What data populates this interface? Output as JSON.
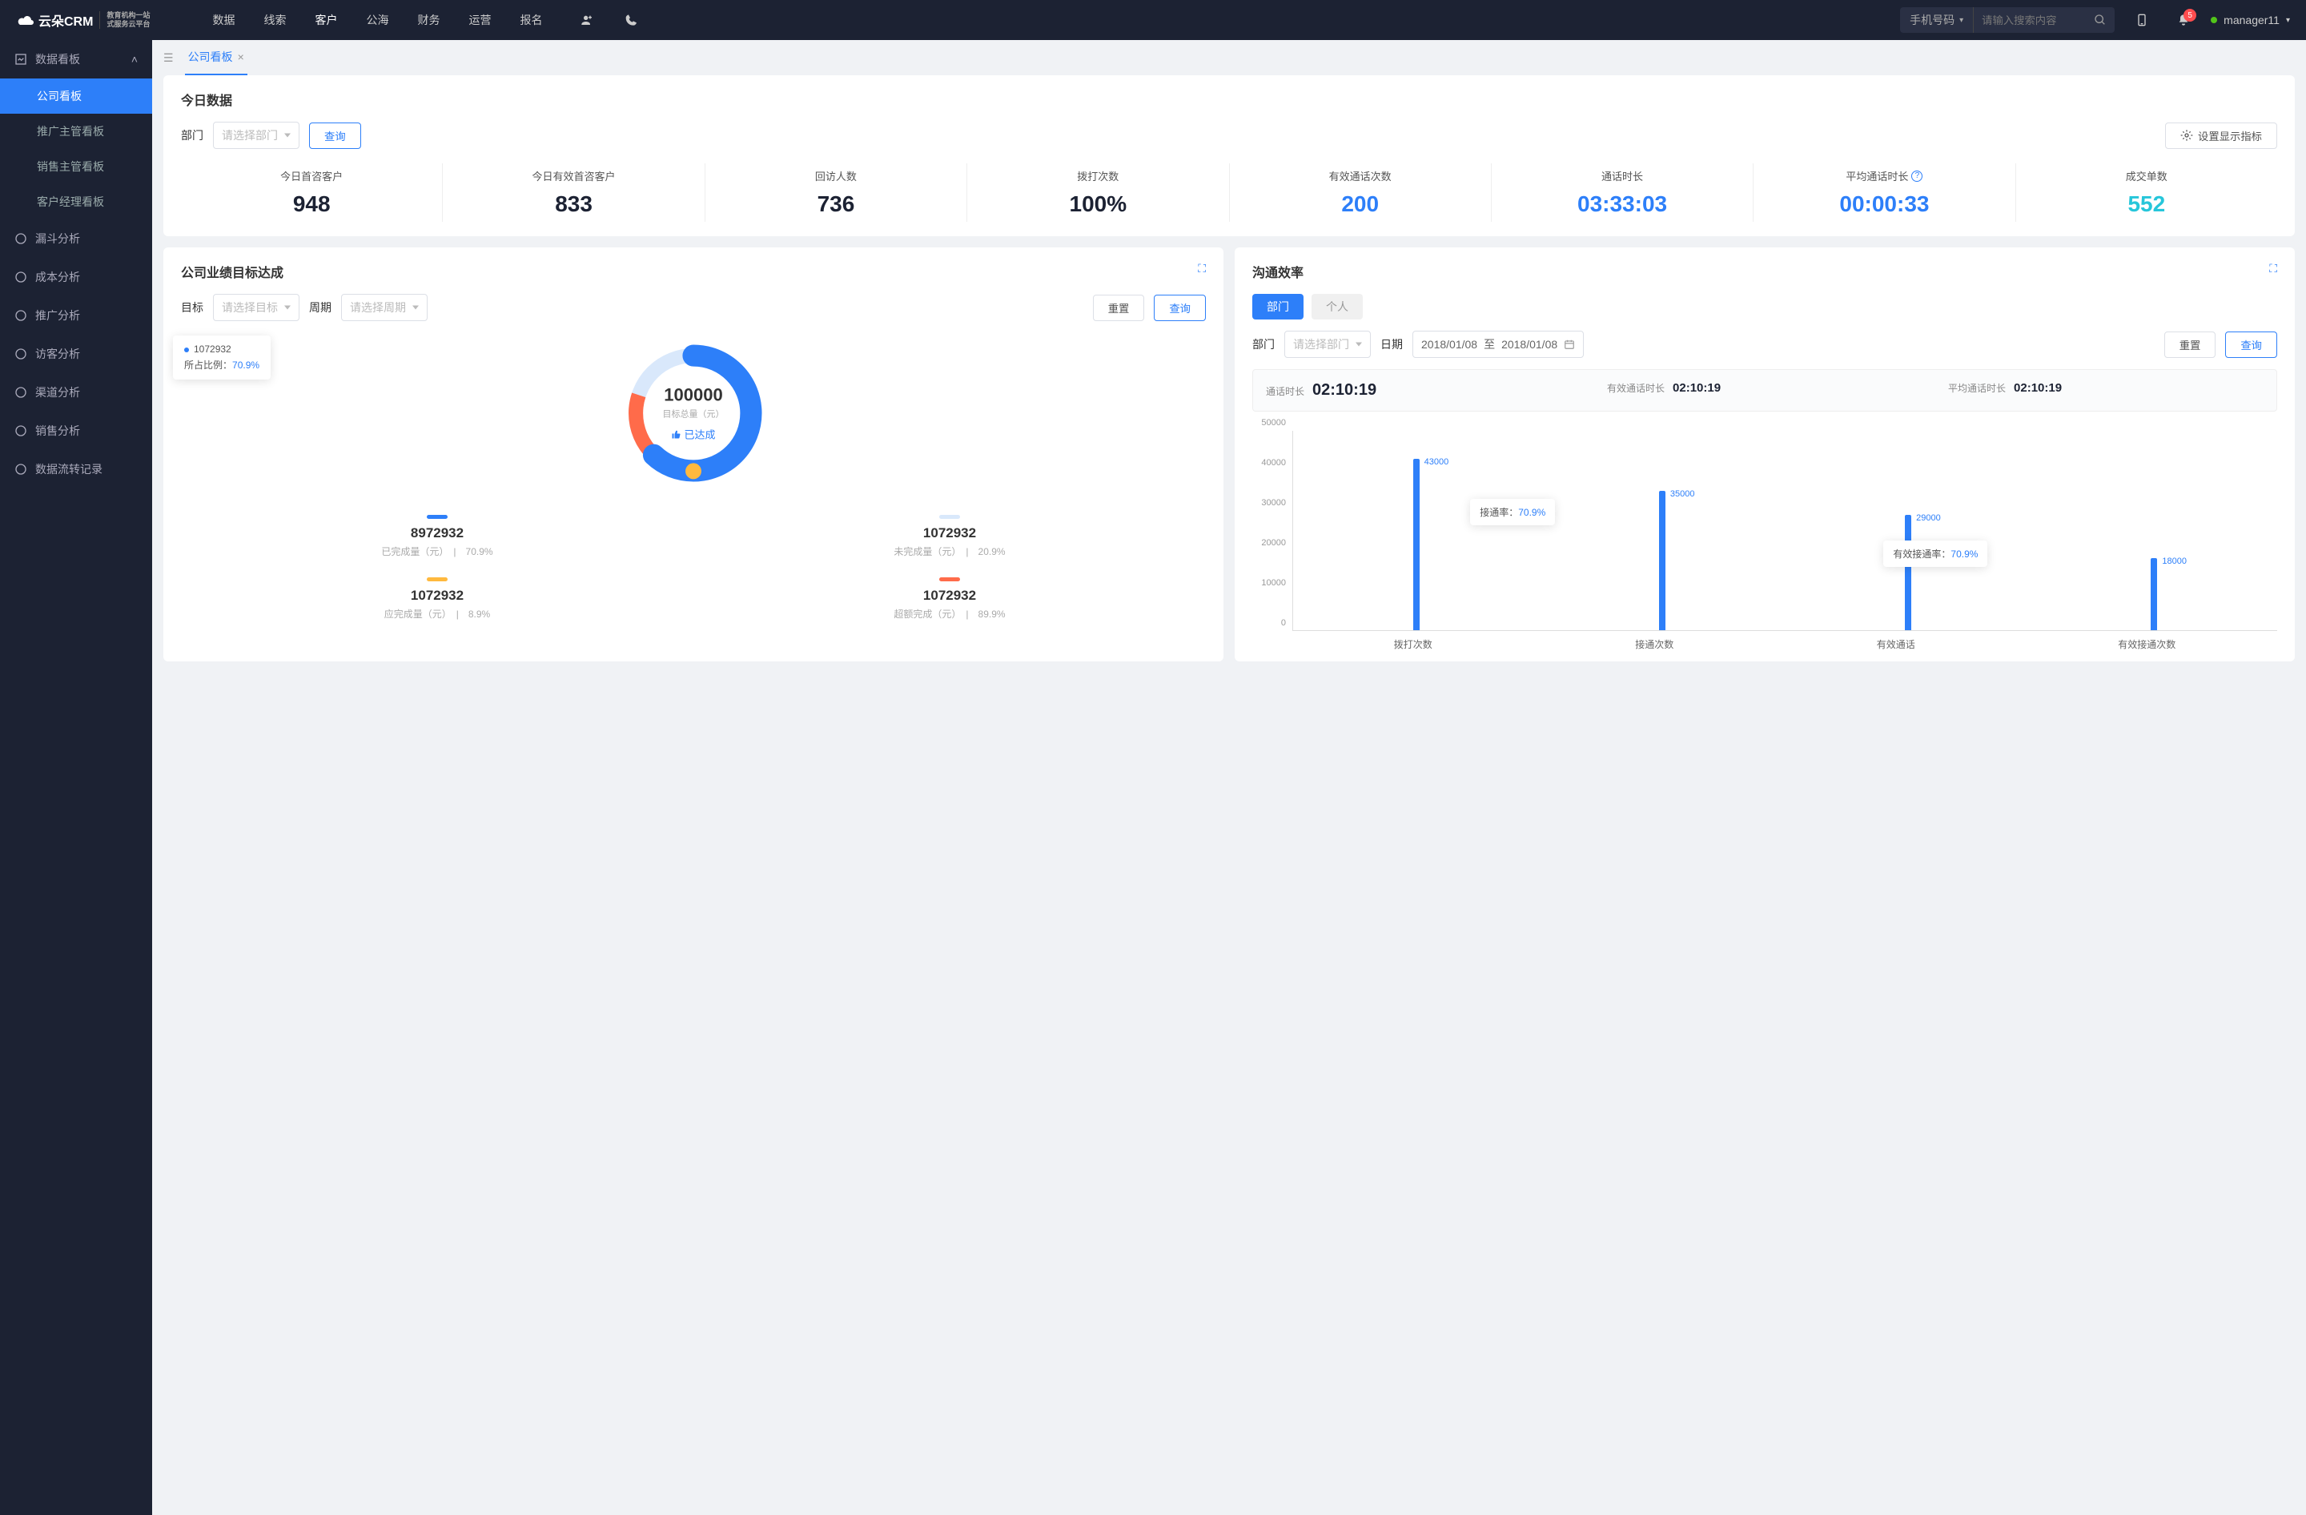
{
  "header": {
    "logo_main": "云朵CRM",
    "logo_sub1": "教育机构一站",
    "logo_sub2": "式服务云平台",
    "nav": [
      "数据",
      "线索",
      "客户",
      "公海",
      "财务",
      "运营",
      "报名"
    ],
    "nav_active": 2,
    "search_type": "手机号码",
    "search_placeholder": "请输入搜索内容",
    "badge_count": "5",
    "username": "manager11"
  },
  "sidebar": {
    "group": "数据看板",
    "items": [
      "公司看板",
      "推广主管看板",
      "销售主管看板",
      "客户经理看板"
    ],
    "active_item": 0,
    "others": [
      "漏斗分析",
      "成本分析",
      "推广分析",
      "访客分析",
      "渠道分析",
      "销售分析",
      "数据流转记录"
    ]
  },
  "tab": {
    "label": "公司看板"
  },
  "today": {
    "title": "今日数据",
    "dept_label": "部门",
    "dept_placeholder": "请选择部门",
    "query_btn": "查询",
    "settings_btn": "设置显示指标",
    "stats": [
      {
        "label": "今日首咨客户",
        "value": "948",
        "cls": "v-dark"
      },
      {
        "label": "今日有效首咨客户",
        "value": "833",
        "cls": "v-dark"
      },
      {
        "label": "回访人数",
        "value": "736",
        "cls": "v-dark"
      },
      {
        "label": "拨打次数",
        "value": "100%",
        "cls": "v-dark"
      },
      {
        "label": "有效通话次数",
        "value": "200",
        "cls": "v-blue"
      },
      {
        "label": "通话时长",
        "value": "03:33:03",
        "cls": "v-blue"
      },
      {
        "label": "平均通话时长",
        "value": "00:00:33",
        "cls": "v-blue",
        "help": true
      },
      {
        "label": "成交单数",
        "value": "552",
        "cls": "v-cyan"
      }
    ]
  },
  "goal": {
    "title": "公司业绩目标达成",
    "target_label": "目标",
    "target_placeholder": "请选择目标",
    "period_label": "周期",
    "period_placeholder": "请选择周期",
    "reset_btn": "重置",
    "query_btn": "查询",
    "center_value": "100000",
    "center_label": "目标总量（元）",
    "center_tag": "已达成",
    "tooltip_value": "1072932",
    "tooltip_ratio_label": "所占比例：",
    "tooltip_ratio": "70.9%",
    "legends": [
      {
        "color": "#2d7ff9",
        "value": "8972932",
        "desc": "已完成量（元）",
        "pct": "70.9%"
      },
      {
        "color": "#d9e8fb",
        "value": "1072932",
        "desc": "未完成量（元）",
        "pct": "20.9%"
      },
      {
        "color": "#ffb93e",
        "value": "1072932",
        "desc": "应完成量（元）",
        "pct": "8.9%"
      },
      {
        "color": "#ff6b4a",
        "value": "1072932",
        "desc": "超额完成（元）",
        "pct": "89.9%"
      }
    ]
  },
  "comm": {
    "title": "沟通效率",
    "seg_tabs": [
      "部门",
      "个人"
    ],
    "dept_label": "部门",
    "dept_placeholder": "请选择部门",
    "date_label": "日期",
    "date_from": "2018/01/08",
    "date_to_label": "至",
    "date_to": "2018/01/08",
    "reset_btn": "重置",
    "query_btn": "查询",
    "summary": [
      {
        "label": "通话时长",
        "value": "02:10:19",
        "big": true
      },
      {
        "label": "有效通话时长",
        "value": "02:10:19"
      },
      {
        "label": "平均通话时长",
        "value": "02:10:19"
      }
    ],
    "tooltip1_label": "接通率：",
    "tooltip1_pct": "70.9%",
    "tooltip2_label": "有效接通率：",
    "tooltip2_pct": "70.9%"
  },
  "chart_data": {
    "type": "bar",
    "categories": [
      "拨打次数",
      "接通次数",
      "有效通话",
      "有效接通次数"
    ],
    "values": [
      43000,
      35000,
      29000,
      18000
    ],
    "ylim": [
      0,
      50000
    ],
    "ytick": 10000,
    "title": "",
    "xlabel": "",
    "ylabel": ""
  }
}
